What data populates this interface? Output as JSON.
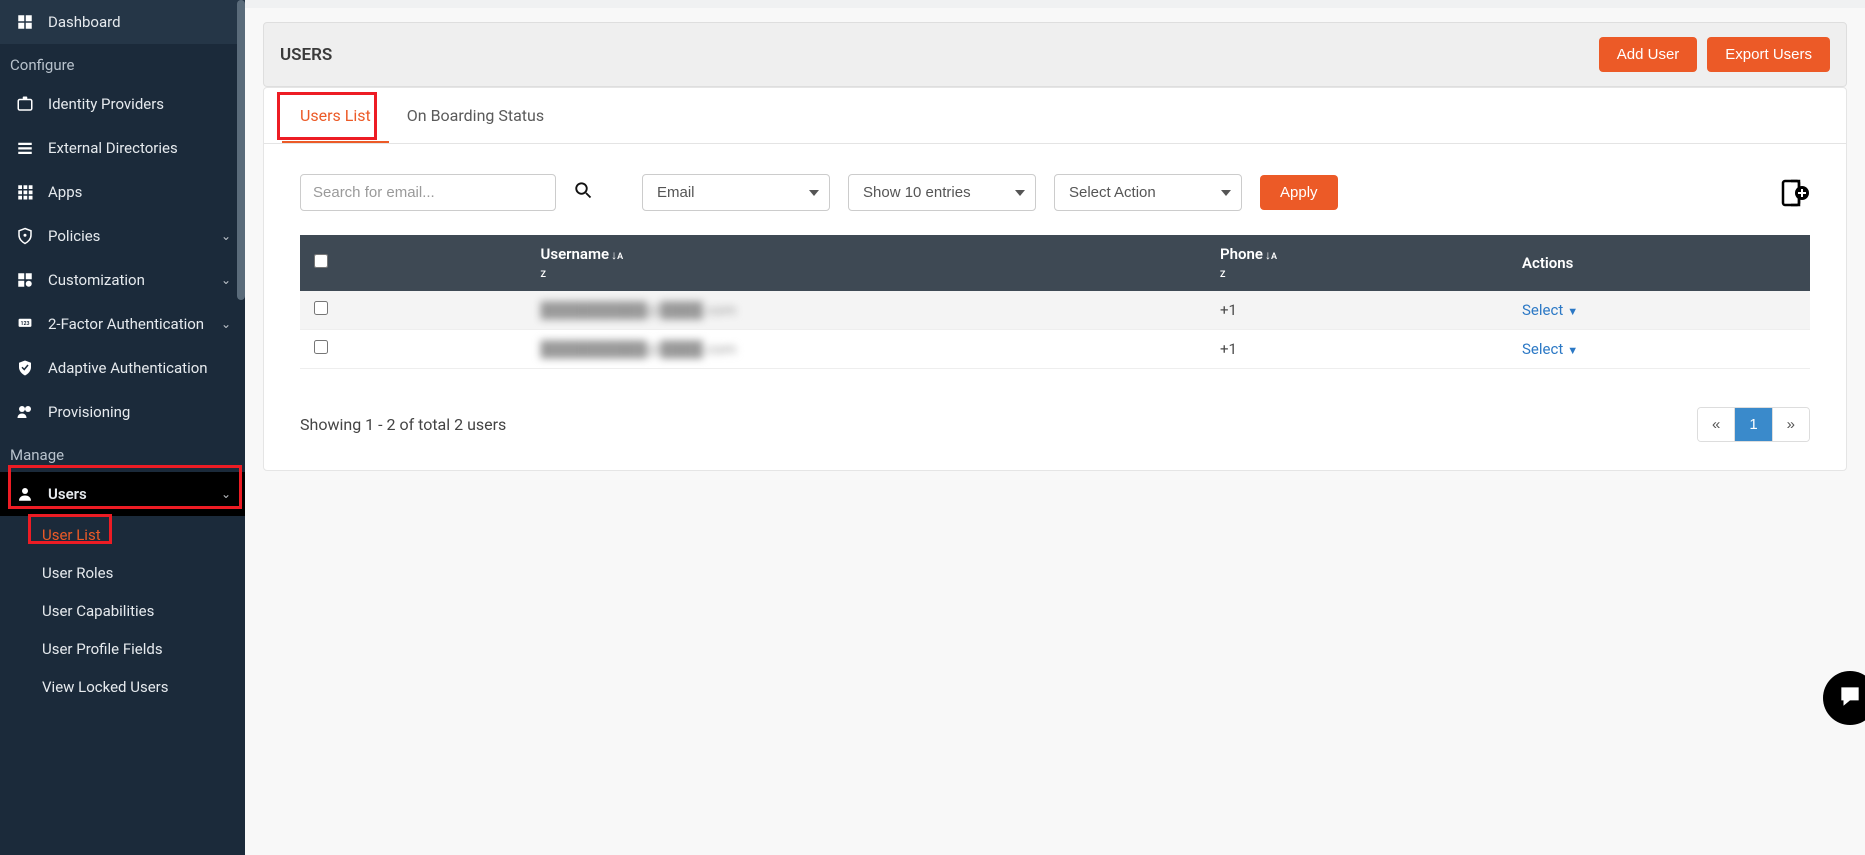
{
  "sidebar": {
    "dashboard": "Dashboard",
    "section_configure": "Configure",
    "identity_providers": "Identity Providers",
    "external_directories": "External Directories",
    "apps": "Apps",
    "policies": "Policies",
    "customization": "Customization",
    "two_factor": "2-Factor Authentication",
    "adaptive_auth": "Adaptive Authentication",
    "provisioning": "Provisioning",
    "section_manage": "Manage",
    "users": "Users",
    "sub": {
      "user_list": "User List",
      "user_roles": "User Roles",
      "user_capabilities": "User Capabilities",
      "user_profile_fields": "User Profile Fields",
      "view_locked_users": "View Locked Users"
    }
  },
  "header": {
    "title": "USERS",
    "add_user": "Add User",
    "export_users": "Export Users"
  },
  "tabs": {
    "users_list": "Users List",
    "onboarding": "On Boarding Status"
  },
  "toolbar": {
    "search_placeholder": "Search for email...",
    "filter_field": "Email",
    "entries": "Show 10 entries",
    "action": "Select Action",
    "apply": "Apply"
  },
  "table": {
    "columns": {
      "username": "Username",
      "phone": "Phone",
      "actions": "Actions"
    },
    "rows": [
      {
        "username": "██████████@████.com",
        "phone": "+1",
        "action": "Select"
      },
      {
        "username": "██████████@████.com",
        "phone": "+1",
        "action": "Select"
      }
    ],
    "select_label": "Select"
  },
  "footer": {
    "showing": "Showing 1 - 2 of total 2 users",
    "prev": "«",
    "page1": "1",
    "next": "»"
  }
}
